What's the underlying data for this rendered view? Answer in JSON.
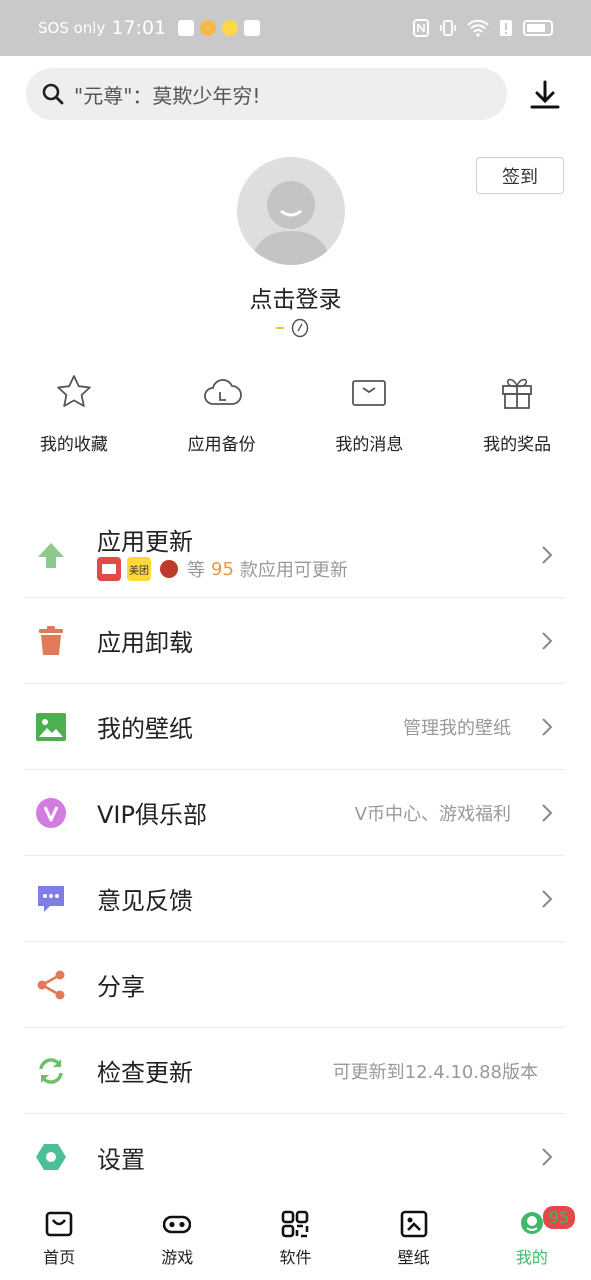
{
  "status": {
    "carrier": "SOS only",
    "time": "17:01"
  },
  "search": {
    "placeholder_label": "\"元尊\"：莫欺少年穷!"
  },
  "header": {
    "checkin_label": "签到",
    "login_label": "点击登录"
  },
  "quick_actions": [
    {
      "label": "我的收藏",
      "icon": "star-icon"
    },
    {
      "label": "应用备份",
      "icon": "cloud-icon"
    },
    {
      "label": "我的消息",
      "icon": "envelope-icon"
    },
    {
      "label": "我的奖品",
      "icon": "gift-icon"
    }
  ],
  "menu": {
    "update": {
      "title": "应用更新",
      "mini_app_2": "美团",
      "sub_prefix": "等",
      "count": "95",
      "sub_suffix": "款应用可更新"
    },
    "uninstall": {
      "title": "应用卸载"
    },
    "wallpaper": {
      "title": "我的壁纸",
      "right": "管理我的壁纸"
    },
    "vip": {
      "title": "VIP俱乐部",
      "right": "V币中心、游戏福利"
    },
    "feedback": {
      "title": "意见反馈"
    },
    "share": {
      "title": "分享"
    },
    "check_update": {
      "title": "检查更新",
      "right": "可更新到12.4.10.88版本"
    },
    "settings": {
      "title": "设置"
    }
  },
  "tabs": [
    {
      "label": "首页",
      "icon": "home-icon"
    },
    {
      "label": "游戏",
      "icon": "gamepad-icon"
    },
    {
      "label": "软件",
      "icon": "apps-icon"
    },
    {
      "label": "壁纸",
      "icon": "wallpaper-icon"
    },
    {
      "label": "我的",
      "icon": "profile-icon",
      "active": true,
      "badge": "95"
    }
  ],
  "colors": {
    "accent_green": "#3cb868",
    "update_orange": "#e8964a",
    "badge_red": "#e24a4a"
  }
}
